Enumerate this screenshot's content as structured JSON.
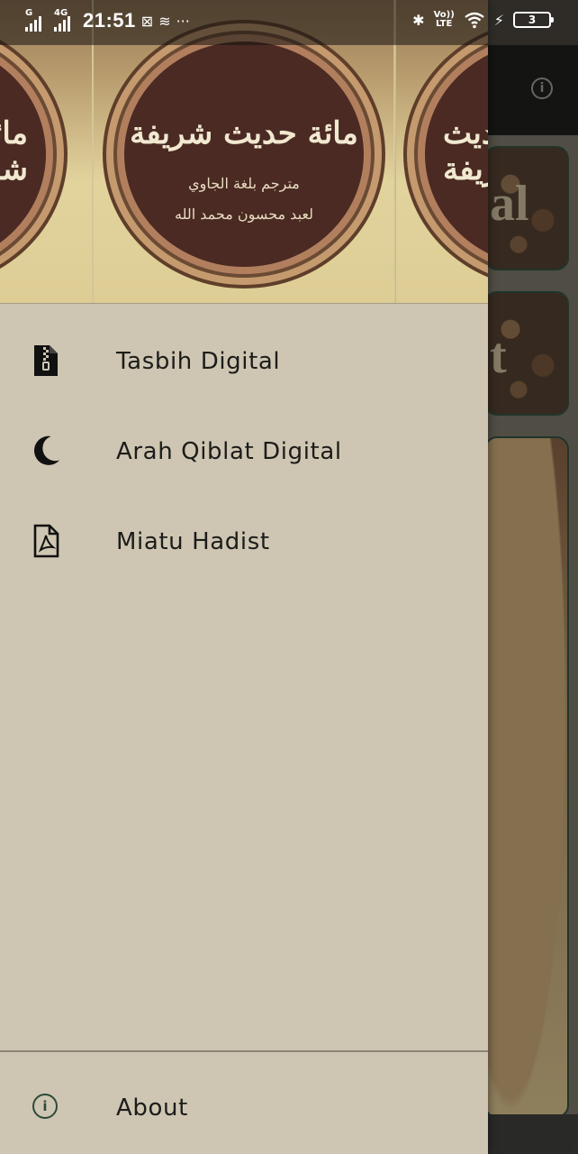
{
  "status_bar": {
    "network_1": "G",
    "network_2": "4G",
    "time": "21:51",
    "more": "···",
    "volte_top": "Vo))",
    "volte_bottom": "LTE",
    "battery": "3"
  },
  "drawer": {
    "header": {
      "arabic_title": "مائة حديث شريفة",
      "arabic_subtitle": "مترجم بلغة الجاوي",
      "arabic_author": "لعبد محسون محمد الله"
    },
    "menu": [
      {
        "label": "Tasbih Digital",
        "icon": "zip-file-icon"
      },
      {
        "label": "Arah Qiblat Digital",
        "icon": "crescent-moon-icon"
      },
      {
        "label": "Miatu Hadist",
        "icon": "pdf-file-icon"
      }
    ],
    "footer": {
      "about_label": "About",
      "about_icon": "info-icon"
    }
  },
  "background_app": {
    "card_1_text": "al",
    "card_2_text": "t"
  },
  "colors": {
    "drawer_bg": "#cec6b2",
    "about_icon": "#2d4a3a",
    "toolbar": "#1d1d1b"
  }
}
